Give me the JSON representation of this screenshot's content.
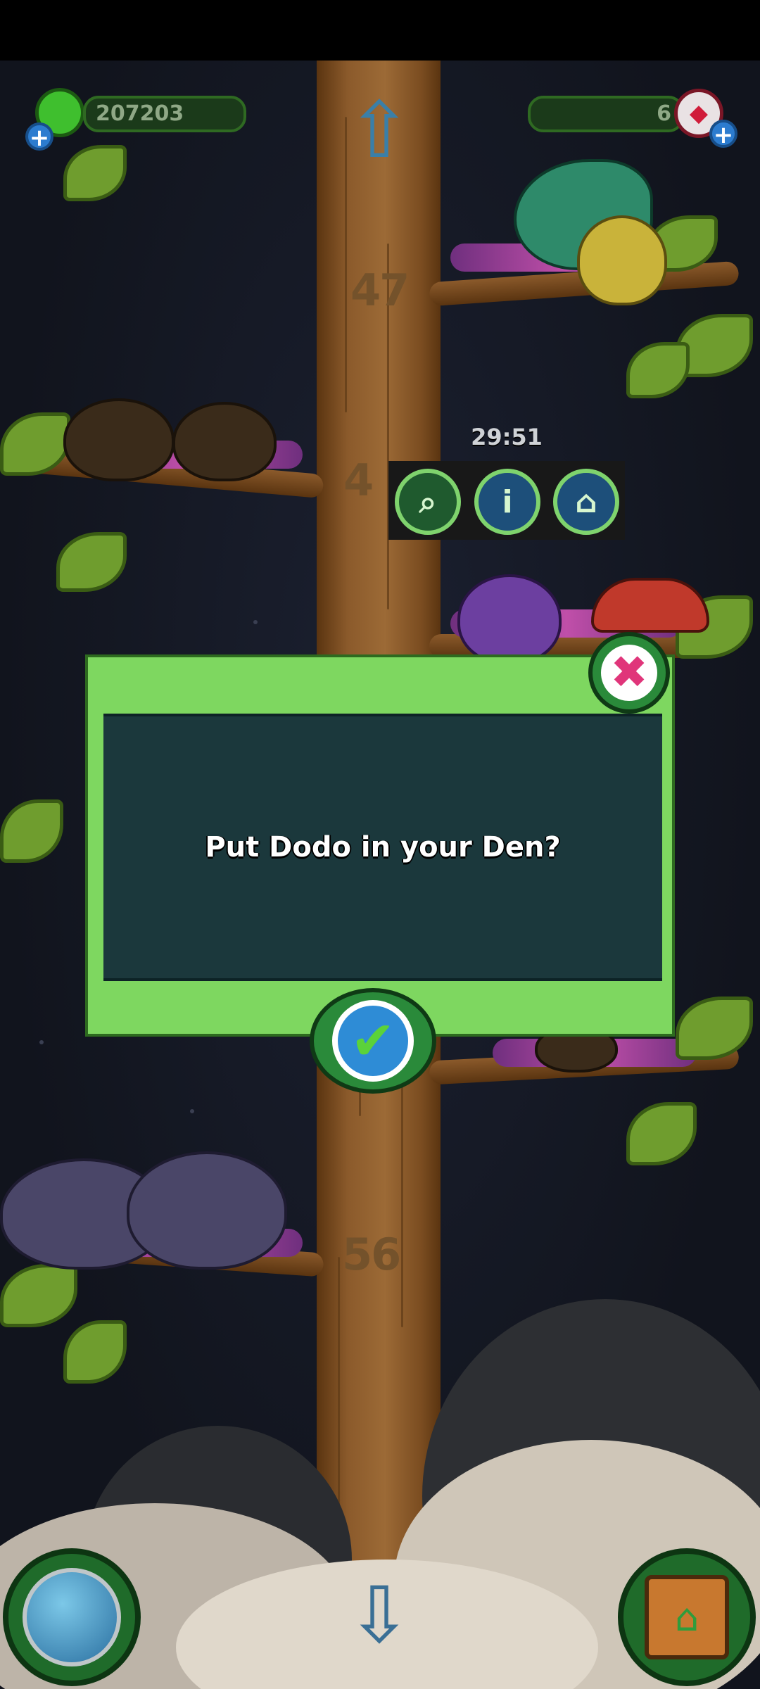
{
  "hud": {
    "coins_value": "207203",
    "gems_value": "6",
    "timer_text": "29:51"
  },
  "tree": {
    "level_numbers": [
      "47",
      "4",
      "56"
    ]
  },
  "dialog": {
    "message": "Put Dodo in your Den?"
  },
  "icons": {
    "coin": "green-coin-icon",
    "gem": "red-gem-icon",
    "up": "up-arrow-icon",
    "down": "down-arrow-icon",
    "net": "net-icon",
    "info": "info-icon",
    "den": "den-icon",
    "close": "close-x-icon",
    "confirm": "checkmark-icon",
    "globe": "globe-icon",
    "house": "house-icon"
  },
  "colors": {
    "dialog_frame": "#7ed760",
    "dialog_body": "#1b383c",
    "close_accent": "#e0357a",
    "confirm_accent": "#2e8cd6"
  }
}
